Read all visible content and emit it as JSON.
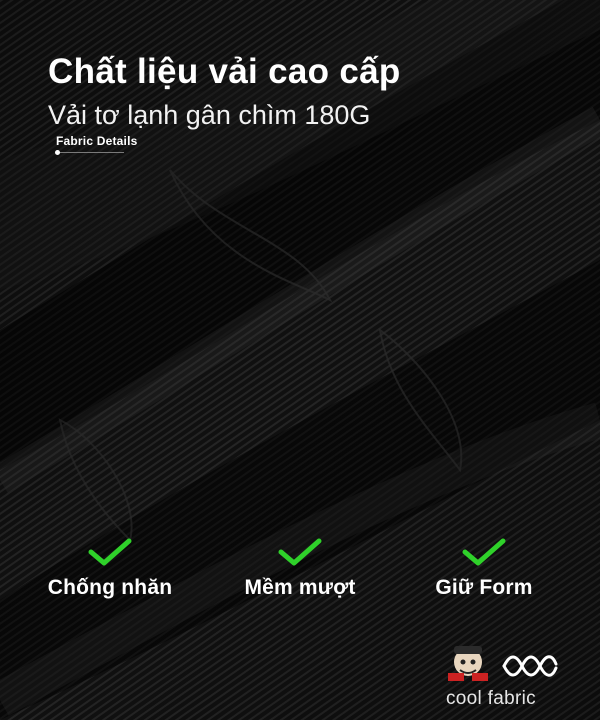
{
  "header": {
    "title": "Chất liệu vải cao cấp",
    "subtitle": "Vải tơ lạnh gân chìm 180G",
    "details_label": "Fabric Details"
  },
  "features": [
    {
      "label": "Chống nhăn",
      "icon": "check-icon"
    },
    {
      "label": "Mềm mượt",
      "icon": "check-icon"
    },
    {
      "label": "Giữ Form",
      "icon": "check-icon"
    }
  ],
  "brand": {
    "mascot_icon": "mascot-logo-icon",
    "wave_icon": "wave-logo-icon",
    "label": "cool fabric"
  },
  "colors": {
    "background": "#0d0d0d",
    "fabric_highlight": "#2a2a2a",
    "check": "#2fd12a",
    "text": "#ffffff"
  }
}
